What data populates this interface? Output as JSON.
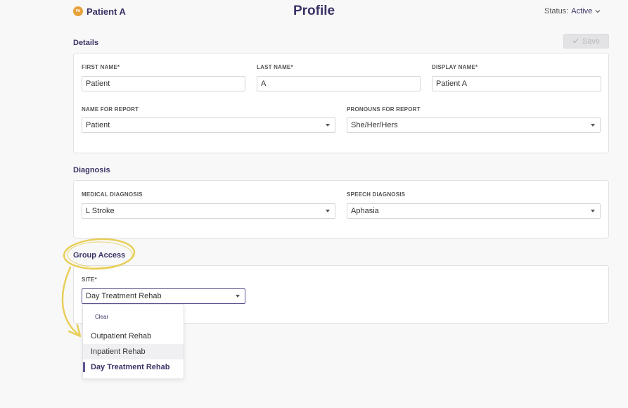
{
  "header": {
    "avatar_initials": "PA",
    "patient_name": "Patient A",
    "title": "Profile",
    "status_label": "Status:",
    "status_value": "Active"
  },
  "details": {
    "section_title": "Details",
    "save_label": "Save",
    "first_name": {
      "label": "FIRST NAME*",
      "value": "Patient"
    },
    "last_name": {
      "label": "LAST NAME*",
      "value": "A"
    },
    "display_name": {
      "label": "DISPLAY NAME*",
      "value": "Patient A"
    },
    "name_for_report": {
      "label": "NAME FOR REPORT",
      "value": "Patient"
    },
    "pronouns": {
      "label": "PRONOUNS FOR REPORT",
      "value": "She/Her/Hers"
    }
  },
  "diagnosis": {
    "section_title": "Diagnosis",
    "medical": {
      "label": "MEDICAL DIAGNOSIS",
      "value": "L Stroke"
    },
    "speech": {
      "label": "SPEECH DIAGNOSIS",
      "value": "Aphasia"
    }
  },
  "group_access": {
    "section_title": "Group Access",
    "site": {
      "label": "SITE*",
      "value": "Day Treatment Rehab"
    },
    "dropdown": {
      "clear_label": "Clear",
      "options": [
        "Outpatient Rehab",
        "Inpatient Rehab",
        "Day Treatment Rehab"
      ],
      "hovered": "Inpatient Rehab",
      "selected": "Day Treatment Rehab"
    }
  },
  "colors": {
    "accent": "#3a3366",
    "avatar": "#e9a13b",
    "annotation": "#e8cf5a"
  },
  "icons": {
    "save": "check-icon",
    "status": "chevron-down-icon",
    "select": "caret-down-icon"
  }
}
